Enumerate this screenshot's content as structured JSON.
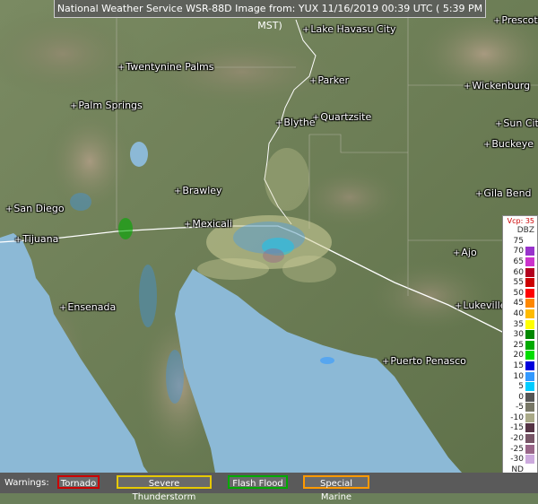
{
  "header": {
    "title": "National Weather Service WSR-88D Image from: YUX 11/16/2019 00:39 UTC ( 5:39 PM MST)"
  },
  "cities": [
    {
      "name": "Lake Havasu City"
    },
    {
      "name": "Prescott"
    },
    {
      "name": "Twentynine Palms"
    },
    {
      "name": "Parker"
    },
    {
      "name": "Wickenburg"
    },
    {
      "name": "Palm Springs"
    },
    {
      "name": "Blythe"
    },
    {
      "name": "Quartzsite"
    },
    {
      "name": "Sun City"
    },
    {
      "name": "Buckeye"
    },
    {
      "name": "Brawley"
    },
    {
      "name": "Gila Bend"
    },
    {
      "name": "San Diego"
    },
    {
      "name": "Mexicali"
    },
    {
      "name": "Tijuana"
    },
    {
      "name": "Ajo"
    },
    {
      "name": "Ensenada"
    },
    {
      "name": "Lukeville"
    },
    {
      "name": "Puerto Penasco"
    }
  ],
  "legend": {
    "header": "Vcp: 35",
    "unit": "DBZ",
    "levels": [
      {
        "label": "75",
        "color": "#ffffff"
      },
      {
        "label": "70",
        "color": "#9933cc"
      },
      {
        "label": "65",
        "color": "#cc33cc"
      },
      {
        "label": "60",
        "color": "#b3001e"
      },
      {
        "label": "55",
        "color": "#cc0000"
      },
      {
        "label": "50",
        "color": "#ff0000"
      },
      {
        "label": "45",
        "color": "#ff8800"
      },
      {
        "label": "40",
        "color": "#ffbb00"
      },
      {
        "label": "35",
        "color": "#ffff00"
      },
      {
        "label": "30",
        "color": "#008800"
      },
      {
        "label": "25",
        "color": "#00aa00"
      },
      {
        "label": "20",
        "color": "#00dd00"
      },
      {
        "label": "15",
        "color": "#0000dd"
      },
      {
        "label": "10",
        "color": "#3399ff"
      },
      {
        "label": "5",
        "color": "#00ccff"
      },
      {
        "label": "0",
        "color": "#555555"
      },
      {
        "label": "-5",
        "color": "#777766"
      },
      {
        "label": "-10",
        "color": "#aaaa88"
      },
      {
        "label": "-15",
        "color": "#553344"
      },
      {
        "label": "-20",
        "color": "#775566"
      },
      {
        "label": "-25",
        "color": "#996688"
      },
      {
        "label": "-30",
        "color": "#ccaadd"
      },
      {
        "label": "ND",
        "color": "#ffffff"
      }
    ]
  },
  "warnings": {
    "label": "Warnings:",
    "items": [
      {
        "label": "Tornado",
        "color": "#cc0000"
      },
      {
        "label": "Severe Thunderstorm",
        "color": "#e6c800"
      },
      {
        "label": "Flash Flood",
        "color": "#00aa00"
      },
      {
        "label": "Special Marine",
        "color": "#ff9900"
      }
    ]
  }
}
